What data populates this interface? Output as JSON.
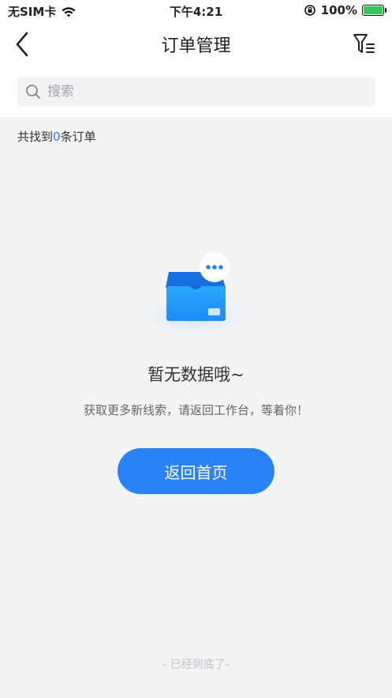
{
  "status_bar": {
    "carrier": "无SIM卡",
    "time": "下午4:21",
    "battery": "100%"
  },
  "nav": {
    "title": "订单管理",
    "back_icon": "chevron-left-icon",
    "filter_icon": "filter-icon"
  },
  "search": {
    "placeholder": "搜索",
    "icon": "search-icon"
  },
  "result": {
    "prefix": "共找到",
    "count": "0",
    "suffix": "条订单"
  },
  "empty_state": {
    "title": "暂无数据哦~",
    "description": "获取更多新线索，请返回工作台，等着你！",
    "button_label": "返回首页",
    "illustration": "empty-box-icon"
  },
  "footer": {
    "hint": "- 已经到底了-"
  },
  "colors": {
    "accent": "#2a82f7",
    "count_highlight": "#2f7cf6",
    "background": "#f2f3f5"
  }
}
